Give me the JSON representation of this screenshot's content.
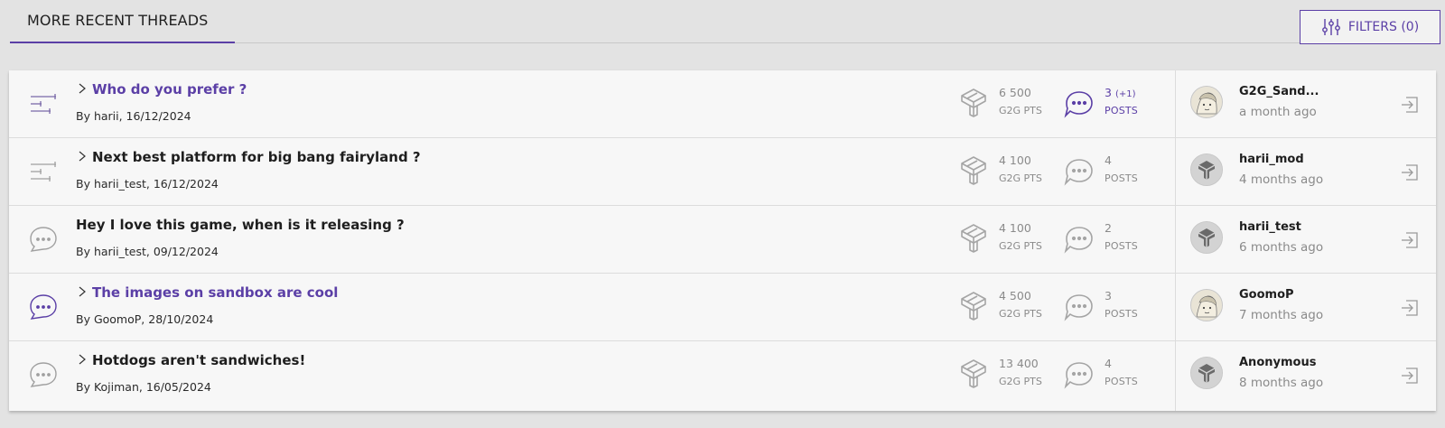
{
  "header": {
    "tab_title": "MORE RECENT THREADS",
    "filters_label": "FILTERS (0)",
    "accent_color": "#5b3fa6"
  },
  "threads": [
    {
      "type_icon": "sort-lines-icon",
      "has_chevron": true,
      "title": "Who do you prefer ?",
      "unread": true,
      "byline": "By harii, 16/12/2024",
      "points": "6 500",
      "points_label": "G2G PTS",
      "posts": "3",
      "posts_new": "(+1)",
      "posts_label": "POSTS",
      "last_user": "G2G_Sand...",
      "last_time": "a month ago",
      "avatar": "illustrated-avatar"
    },
    {
      "type_icon": "sort-lines-icon",
      "has_chevron": true,
      "title": "Next best platform for big bang fairyland ?",
      "unread": false,
      "byline": "By harii_test, 16/12/2024",
      "points": "4 100",
      "points_label": "G2G PTS",
      "posts": "4",
      "posts_new": "",
      "posts_label": "POSTS",
      "last_user": "harii_mod",
      "last_time": "4 months ago",
      "avatar": "logo-avatar"
    },
    {
      "type_icon": "chat-bubble-icon",
      "has_chevron": false,
      "title": "Hey I love this game, when is it releasing ?",
      "unread": false,
      "byline": "By harii_test, 09/12/2024",
      "points": "4 100",
      "points_label": "G2G PTS",
      "posts": "2",
      "posts_new": "",
      "posts_label": "POSTS",
      "last_user": "harii_test",
      "last_time": "6 months ago",
      "avatar": "logo-avatar"
    },
    {
      "type_icon": "chat-bubble-icon",
      "has_chevron": true,
      "title": "The images on sandbox are cool",
      "unread": true,
      "byline": "By GoomoP, 28/10/2024",
      "points": "4 500",
      "points_label": "G2G PTS",
      "posts": "3",
      "posts_new": "",
      "posts_label": "POSTS",
      "last_user": "GoomoP",
      "last_time": "7 months ago",
      "avatar": "illustrated-avatar"
    },
    {
      "type_icon": "chat-bubble-icon",
      "has_chevron": true,
      "title": "Hotdogs aren't sandwiches!",
      "unread": false,
      "byline": "By Kojiman, 16/05/2024",
      "points": "13 400",
      "points_label": "G2G PTS",
      "posts": "4",
      "posts_new": "",
      "posts_label": "POSTS",
      "last_user": "Anonymous",
      "last_time": "8 months ago",
      "avatar": "logo-avatar"
    }
  ]
}
